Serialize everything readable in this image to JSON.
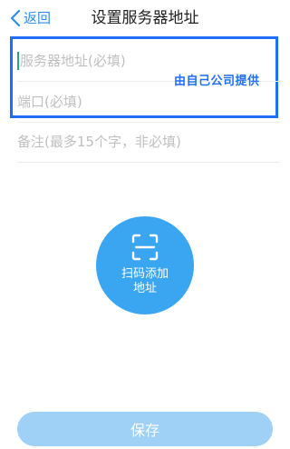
{
  "header": {
    "back_label": "返回",
    "title": "设置服务器地址"
  },
  "form": {
    "address_placeholder": "服务器地址(必填)",
    "port_placeholder": "端口(必填)",
    "note_placeholder": "备注(最多15个字，非必填)",
    "annotation": "由自己公司提供"
  },
  "scan": {
    "label_line1": "扫码添加",
    "label_line2": "地址"
  },
  "footer": {
    "save_label": "保存"
  },
  "colors": {
    "accent": "#2c8ff2",
    "highlight": "#1f6ef5",
    "scan_button": "#3aa6f2",
    "save_button": "#9fd1f6"
  }
}
